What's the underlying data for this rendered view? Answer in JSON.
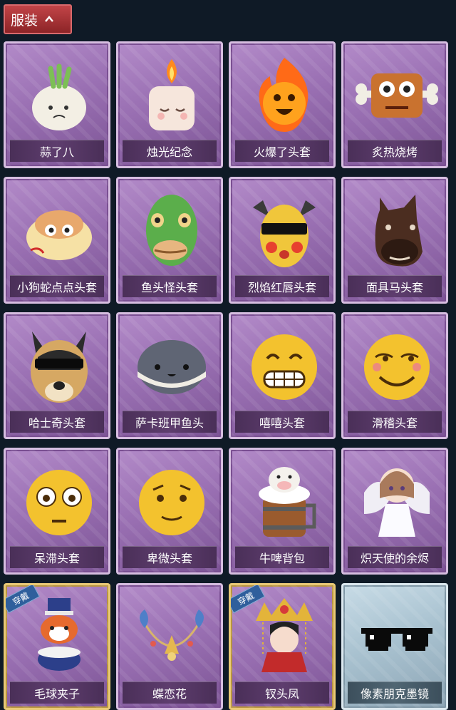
{
  "header": {
    "title": "服装",
    "icon": "chevron-up-icon"
  },
  "equipped_tag": "穿戴",
  "items": [
    {
      "name": "蒜了八",
      "icon": "garlic-icon",
      "equipped": false,
      "style": "purple"
    },
    {
      "name": "烛光纪念",
      "icon": "candle-icon",
      "equipped": false,
      "style": "purple"
    },
    {
      "name": "火爆了头套",
      "icon": "fireball-icon",
      "equipped": false,
      "style": "purple"
    },
    {
      "name": "炙热烧烤",
      "icon": "bbq-meat-icon",
      "equipped": false,
      "style": "purple"
    },
    {
      "name": "小狗蛇点点头套",
      "icon": "snake-dog-icon",
      "equipped": false,
      "style": "purple"
    },
    {
      "name": "鱼头怪头套",
      "icon": "fish-head-icon",
      "equipped": false,
      "style": "purple"
    },
    {
      "name": "烈焰红唇头套",
      "icon": "pikachu-mask-icon",
      "equipped": false,
      "style": "purple"
    },
    {
      "name": "面具马头套",
      "icon": "horse-mask-icon",
      "equipped": false,
      "style": "purple"
    },
    {
      "name": "哈士奇头套",
      "icon": "husky-icon",
      "equipped": false,
      "style": "purple"
    },
    {
      "name": "萨卡班甲鱼头",
      "icon": "sacabambaspis-icon",
      "equipped": false,
      "style": "purple"
    },
    {
      "name": "嘻嘻头套",
      "icon": "grin-emoji-icon",
      "equipped": false,
      "style": "purple"
    },
    {
      "name": "滑稽头套",
      "icon": "funny-emoji-icon",
      "equipped": false,
      "style": "purple"
    },
    {
      "name": "呆滞头套",
      "icon": "flushed-emoji-icon",
      "equipped": false,
      "style": "purple"
    },
    {
      "name": "卑微头套",
      "icon": "humble-emoji-icon",
      "equipped": false,
      "style": "purple"
    },
    {
      "name": "牛啤背包",
      "icon": "cow-beer-icon",
      "equipped": false,
      "style": "purple"
    },
    {
      "name": "炽天使的余烬",
      "icon": "angel-icon",
      "equipped": false,
      "style": "purple"
    },
    {
      "name": "毛球夹子",
      "icon": "raccoon-drummer-icon",
      "equipped": true,
      "style": "purple"
    },
    {
      "name": "蝶恋花",
      "icon": "butterfly-necklace-icon",
      "equipped": false,
      "style": "purple"
    },
    {
      "name": "钗头凤",
      "icon": "phoenix-crown-icon",
      "equipped": true,
      "style": "purple"
    },
    {
      "name": "像素朋克墨镜",
      "icon": "pixel-sunglasses-icon",
      "equipped": false,
      "style": "blue"
    }
  ]
}
